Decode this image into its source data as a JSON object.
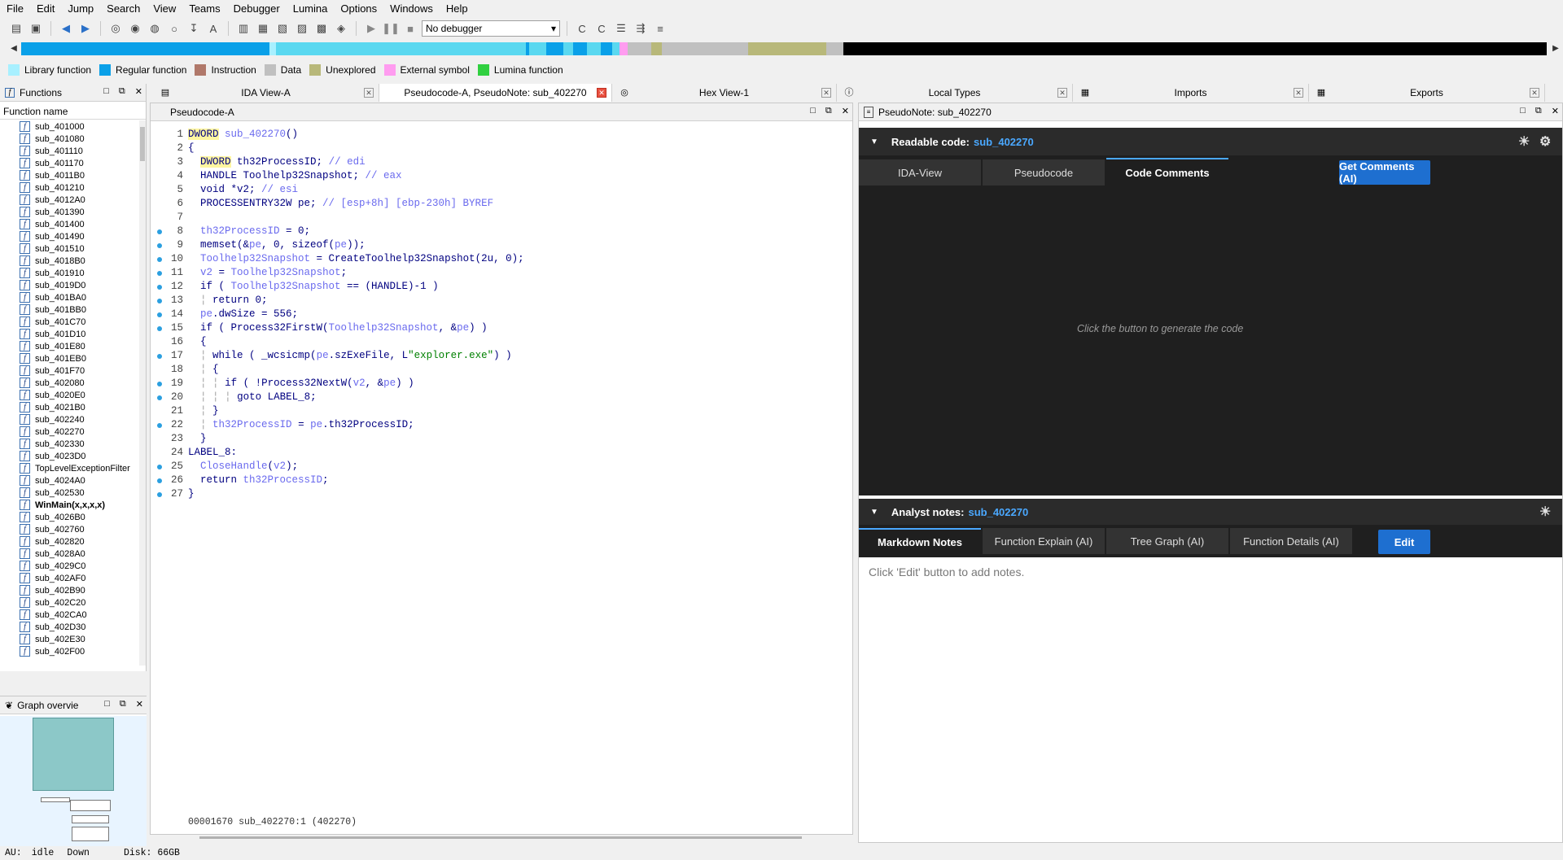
{
  "menu": [
    "File",
    "Edit",
    "Jump",
    "Search",
    "View",
    "Teams",
    "Debugger",
    "Lumina",
    "Options",
    "Windows",
    "Help"
  ],
  "toolbar": {
    "debugger_select": "No debugger"
  },
  "legend": [
    {
      "label": "Library function",
      "color": "#a8f0ff"
    },
    {
      "label": "Regular function",
      "color": "#0aa0e8"
    },
    {
      "label": "Instruction",
      "color": "#b0786a"
    },
    {
      "label": "Data",
      "color": "#c0c0c0"
    },
    {
      "label": "Unexplored",
      "color": "#b8b87a"
    },
    {
      "label": "External symbol",
      "color": "#ff9cf0"
    },
    {
      "label": "Lumina function",
      "color": "#30d040"
    }
  ],
  "functions_panel": {
    "title": "Functions",
    "column_header": "Function name",
    "items": [
      "sub_401000",
      "sub_401080",
      "sub_401110",
      "sub_401170",
      "sub_4011B0",
      "sub_401210",
      "sub_4012A0",
      "sub_401390",
      "sub_401400",
      "sub_401490",
      "sub_401510",
      "sub_4018B0",
      "sub_401910",
      "sub_4019D0",
      "sub_401BA0",
      "sub_401BB0",
      "sub_401C70",
      "sub_401D10",
      "sub_401E80",
      "sub_401EB0",
      "sub_401F70",
      "sub_402080",
      "sub_4020E0",
      "sub_4021B0",
      "sub_402240",
      "sub_402270",
      "sub_402330",
      "sub_4023D0",
      "TopLevelExceptionFilter",
      "sub_4024A0",
      "sub_402530",
      "WinMain(x,x,x,x)",
      "sub_4026B0",
      "sub_402760",
      "sub_402820",
      "sub_4028A0",
      "sub_4029C0",
      "sub_402AF0",
      "sub_402B90",
      "sub_402C20",
      "sub_402CA0",
      "sub_402D30",
      "sub_402E30",
      "sub_402F00"
    ],
    "bold_item": "WinMain(x,x,x,x)"
  },
  "graph_panel": {
    "title": "Graph overvie"
  },
  "tabs": {
    "ida_view": "IDA View-A",
    "pseudocode": "Pseudocode-A, PseudoNote: sub_402270",
    "hex_view": "Hex View-1",
    "local_types": "Local Types",
    "imports": "Imports",
    "exports": "Exports"
  },
  "pseudocode_panel": {
    "title": "Pseudocode-A",
    "status": "00001670 sub_402270:1 (402270)"
  },
  "note_panel": {
    "title": "PseudoNote: sub_402270",
    "readable_title": "Readable code:",
    "function_name": "sub_402270",
    "readable_tabs": [
      "IDA-View",
      "Pseudocode",
      "Code Comments"
    ],
    "get_comments_btn": "Get Comments (AI)",
    "readable_hint": "Click the button to generate the code",
    "analyst_title": "Analyst notes:",
    "analyst_tabs": [
      "Markdown Notes",
      "Function Explain (AI)",
      "Tree Graph (AI)",
      "Function Details (AI)"
    ],
    "edit_btn": "Edit",
    "analyst_hint": "Click 'Edit' button to add notes."
  },
  "statusbar": {
    "au_label": "AU:",
    "au_state": "idle",
    "direction": "Down",
    "disk": "Disk: 66GB"
  }
}
